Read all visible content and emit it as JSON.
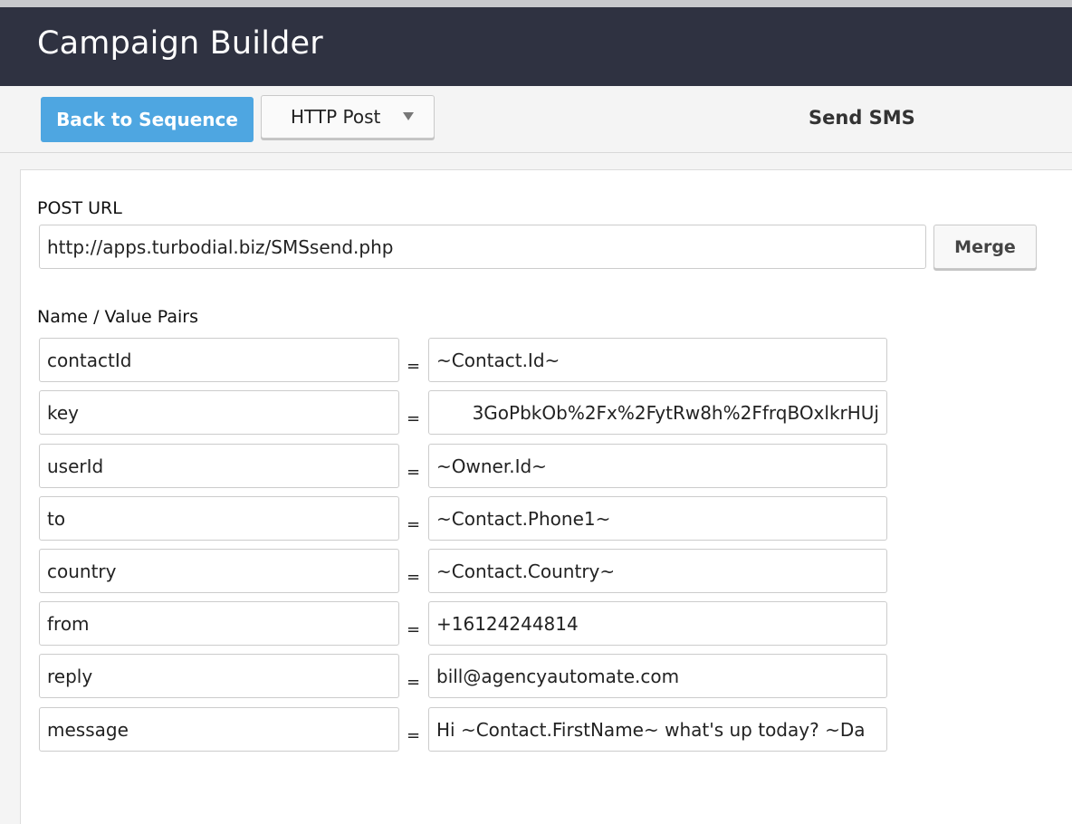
{
  "header": {
    "title": "Campaign Builder"
  },
  "toolbar": {
    "back_label": "Back to Sequence",
    "method_value": "HTTP Post",
    "heading": "Send SMS"
  },
  "form": {
    "post_url_label": "POST URL",
    "post_url_value": "http://apps.turbodial.biz/SMSsend.php",
    "merge_label": "Merge",
    "pairs_label": "Name / Value Pairs",
    "equals": "=",
    "pairs": [
      {
        "name": "contactId",
        "value": "~Contact.Id~"
      },
      {
        "name": "key",
        "value": "3GoPbkOb%2Fx%2FytRw8h%2FfrqBOxlkrHUj"
      },
      {
        "name": "userId",
        "value": "~Owner.Id~"
      },
      {
        "name": "to",
        "value": "~Contact.Phone1~"
      },
      {
        "name": "country",
        "value": "~Contact.Country~"
      },
      {
        "name": "from",
        "value": "+16124244814"
      },
      {
        "name": "reply",
        "value": "bill@agencyautomate.com"
      },
      {
        "name": "message",
        "value": "Hi ~Contact.FirstName~ what's up today? ~Da"
      }
    ]
  }
}
